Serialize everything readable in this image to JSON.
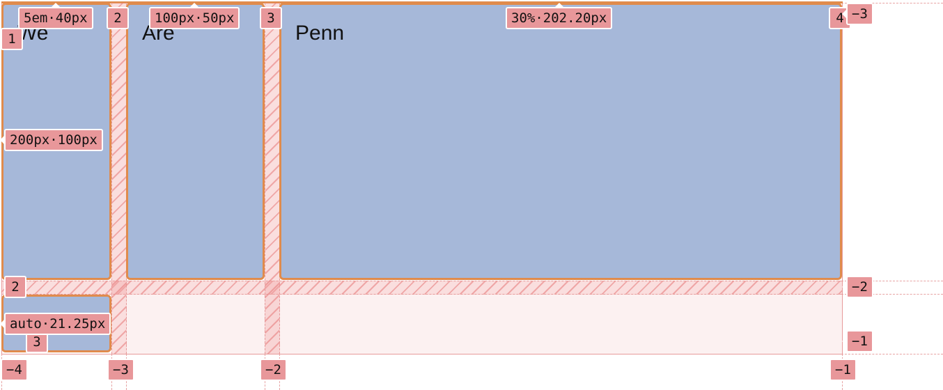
{
  "grid": {
    "items": [
      "We",
      "Are",
      "Penn",
      ""
    ],
    "column_size_labels": [
      "5em·40px",
      "100px·50px",
      "30%·202.20px"
    ],
    "row_size_labels": [
      "200px·100px",
      "auto·21.25px"
    ],
    "column_line_numbers_top": [
      "1",
      "2",
      "3",
      "4"
    ],
    "column_line_numbers_bottom": [
      "−4",
      "−3",
      "−2",
      "−1"
    ],
    "row_line_numbers_left": [
      "1",
      "2",
      "3"
    ],
    "row_line_numbers_right": [
      "−3",
      "−2",
      "−1"
    ]
  },
  "colors": {
    "item_fill": "#a6b8d9",
    "item_border": "#e08b4c",
    "overlay_label": "#e8979a",
    "gap_fill": "#f4cfcf"
  }
}
